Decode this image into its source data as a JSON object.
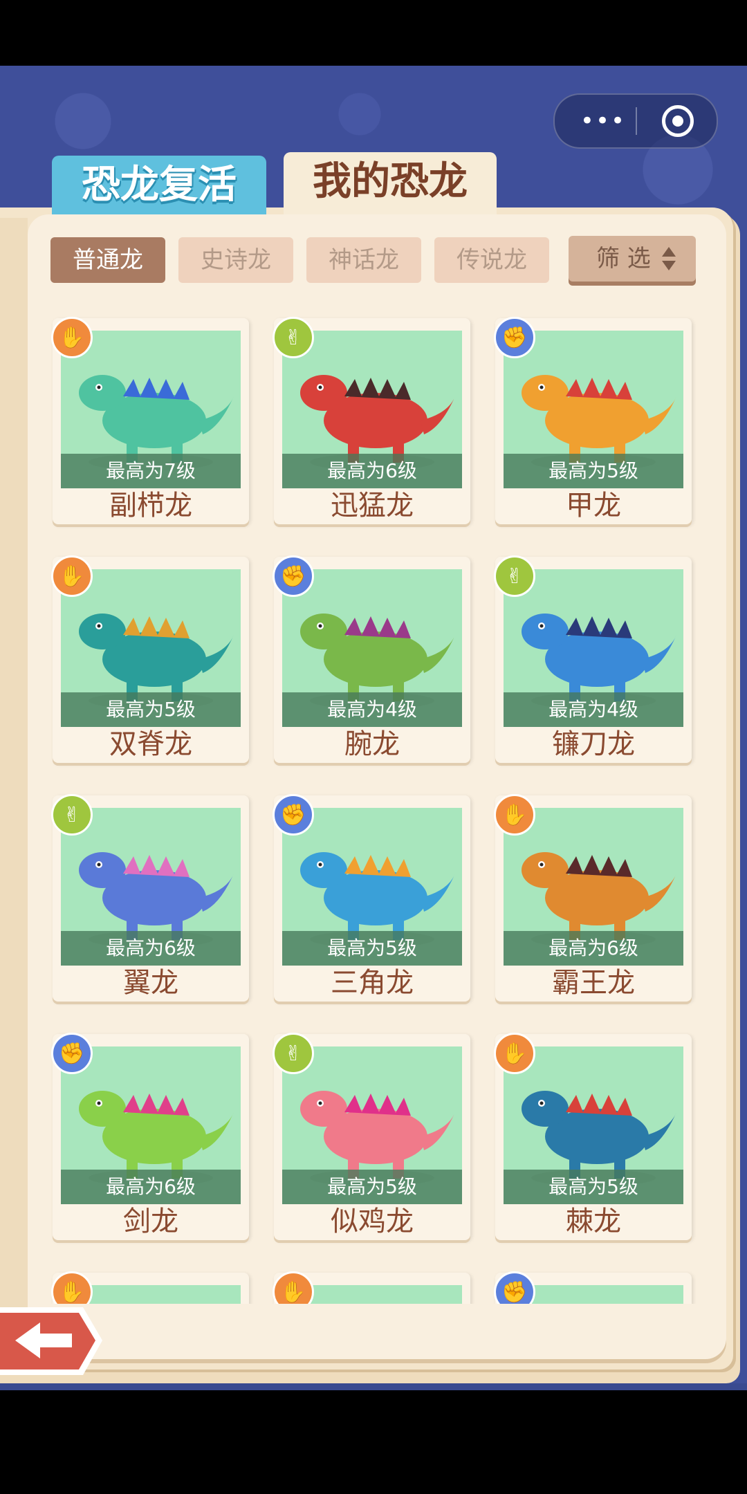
{
  "tabs": [
    {
      "label": "恐龙复活",
      "active": false
    },
    {
      "label": "我的恐龙",
      "active": true
    }
  ],
  "filters": [
    {
      "label": "普通龙",
      "active": true
    },
    {
      "label": "史诗龙",
      "active": false
    },
    {
      "label": "神话龙",
      "active": false
    },
    {
      "label": "传说龙",
      "active": false
    }
  ],
  "sort": {
    "label": "筛 选"
  },
  "capsule": {
    "more": "•••"
  },
  "cards": [
    {
      "name": "副栉龙",
      "level": "最高为7级",
      "badge": "paper",
      "color": "#4fc3a0",
      "accent": "#3a6bd8"
    },
    {
      "name": "迅猛龙",
      "level": "最高为6级",
      "badge": "scissors",
      "color": "#d8413a",
      "accent": "#4a2a2a"
    },
    {
      "name": "甲龙",
      "level": "最高为5级",
      "badge": "rock",
      "color": "#f0a030",
      "accent": "#d8413a"
    },
    {
      "name": "双脊龙",
      "level": "最高为5级",
      "badge": "paper",
      "color": "#2a9e9a",
      "accent": "#e0a030"
    },
    {
      "name": "腕龙",
      "level": "最高为4级",
      "badge": "rock",
      "color": "#7ab84a",
      "accent": "#9a3a8a"
    },
    {
      "name": "镰刀龙",
      "level": "最高为4级",
      "badge": "scissors",
      "color": "#3a8ad8",
      "accent": "#2a3a7a"
    },
    {
      "name": "翼龙",
      "level": "最高为6级",
      "badge": "scissors",
      "color": "#5a7ad8",
      "accent": "#e070c0"
    },
    {
      "name": "三角龙",
      "level": "最高为5级",
      "badge": "rock",
      "color": "#3aa0d8",
      "accent": "#f0a030"
    },
    {
      "name": "霸王龙",
      "level": "最高为6级",
      "badge": "paper",
      "color": "#e08a30",
      "accent": "#5a2a2a"
    },
    {
      "name": "剑龙",
      "level": "最高为6级",
      "badge": "rock",
      "color": "#8ad04a",
      "accent": "#e0408a"
    },
    {
      "name": "似鸡龙",
      "level": "最高为5级",
      "badge": "scissors",
      "color": "#f07a8a",
      "accent": "#e0308a"
    },
    {
      "name": "棘龙",
      "level": "最高为5级",
      "badge": "paper",
      "color": "#2a7aa8",
      "accent": "#d8413a"
    },
    {
      "name": "",
      "level": "",
      "badge": "paper",
      "color": "#5a3a3a",
      "accent": "#5a3a3a"
    },
    {
      "name": "",
      "level": "",
      "badge": "paper",
      "color": "#f0c030",
      "accent": "#d8413a"
    },
    {
      "name": "",
      "level": "",
      "badge": "rock",
      "color": "#a8e6bd",
      "accent": "#a8e6bd"
    }
  ]
}
